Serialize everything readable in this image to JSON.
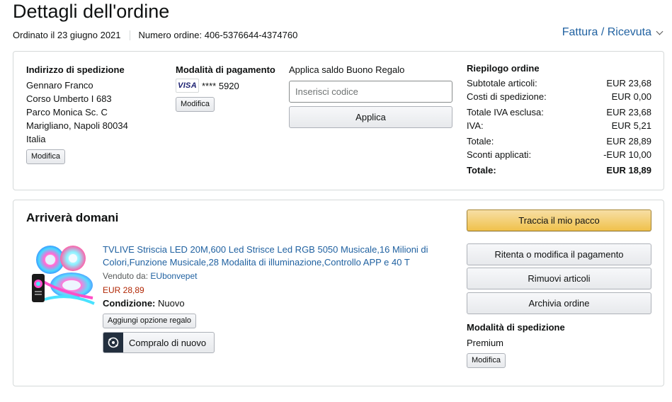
{
  "header": {
    "title": "Dettagli dell'ordine",
    "ordered_on": "Ordinato il 23 giugno 2021",
    "order_number": "Numero ordine: 406-5376644-4374760",
    "invoice_link": "Fattura / Ricevuta"
  },
  "shipping_address": {
    "heading": "Indirizzo di spedizione",
    "lines": [
      "Gennaro Franco",
      "Corso Umberto I 683",
      "Parco Monica Sc. C",
      "Marigliano, Napoli 80034",
      "Italia"
    ],
    "edit_label": "Modifica"
  },
  "payment": {
    "heading": "Modalità di pagamento",
    "card_brand": "VISA",
    "card_number": "**** 5920",
    "edit_label": "Modifica"
  },
  "gift_card": {
    "heading": "Applica saldo Buono Regalo",
    "placeholder": "Inserisci codice",
    "apply_label": "Applica"
  },
  "summary": {
    "heading": "Riepilogo ordine",
    "rows": [
      {
        "label": "Subtotale articoli:",
        "value": "EUR 23,68"
      },
      {
        "label": "Costi di spedizione:",
        "value": "EUR 0,00"
      },
      {
        "label": "Totale IVA esclusa:",
        "value": "EUR 23,68"
      },
      {
        "label": "IVA:",
        "value": "EUR 5,21"
      },
      {
        "label": "Totale:",
        "value": "EUR 28,89"
      },
      {
        "label": "Sconti applicati:",
        "value": "-EUR 10,00"
      }
    ],
    "grand_total_label": "Totale:",
    "grand_total_value": "EUR 18,89"
  },
  "shipment": {
    "heading": "Arriverà domani",
    "product_title": "TVLIVE Striscia LED 20M,600 Led Strisce Led RGB 5050 Musicale,16 Milioni di Colori,Funzione Musicale,28 Modalita di illuminazione,Controllo APP e 40 T",
    "sold_by_label": "Venduto da:",
    "seller": "EUbonvepet",
    "price": "EUR 28,89",
    "condition_label": "Condizione:",
    "condition_value": "Nuovo",
    "gift_option_label": "Aggiungi opzione regalo",
    "buy_again_label": "Compralo di nuovo"
  },
  "actions": {
    "track": "Traccia il mio pacco",
    "retry_payment": "Ritenta o modifica il pagamento",
    "remove_items": "Rimuovi articoli",
    "archive": "Archivia ordine",
    "ship_method_heading": "Modalità di spedizione",
    "ship_method_value": "Premium",
    "ship_edit_label": "Modifica"
  },
  "colors": {
    "link": "#2162a1",
    "price": "#b12704",
    "primary_button": "#f0c14b"
  }
}
